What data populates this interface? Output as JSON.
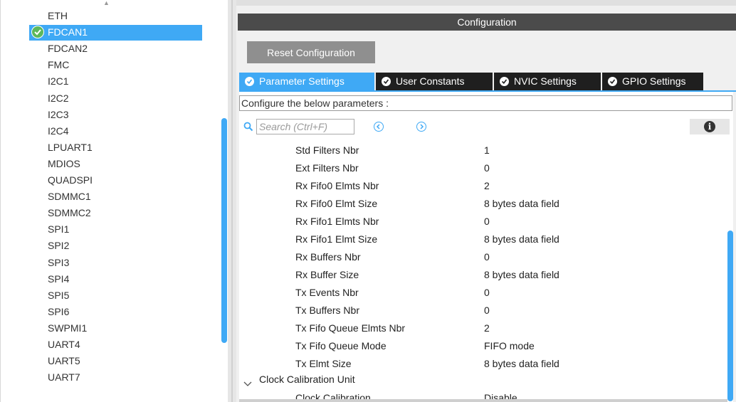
{
  "peripherals": {
    "items": [
      {
        "label": "ETH",
        "selected": false,
        "checked": false
      },
      {
        "label": "FDCAN1",
        "selected": true,
        "checked": true
      },
      {
        "label": "FDCAN2",
        "selected": false,
        "checked": false
      },
      {
        "label": "FMC",
        "selected": false,
        "checked": false
      },
      {
        "label": "I2C1",
        "selected": false,
        "checked": false
      },
      {
        "label": "I2C2",
        "selected": false,
        "checked": false
      },
      {
        "label": "I2C3",
        "selected": false,
        "checked": false
      },
      {
        "label": "I2C4",
        "selected": false,
        "checked": false
      },
      {
        "label": "LPUART1",
        "selected": false,
        "checked": false
      },
      {
        "label": "MDIOS",
        "selected": false,
        "checked": false
      },
      {
        "label": "QUADSPI",
        "selected": false,
        "checked": false
      },
      {
        "label": "SDMMC1",
        "selected": false,
        "checked": false
      },
      {
        "label": "SDMMC2",
        "selected": false,
        "checked": false
      },
      {
        "label": "SPI1",
        "selected": false,
        "checked": false
      },
      {
        "label": "SPI2",
        "selected": false,
        "checked": false
      },
      {
        "label": "SPI3",
        "selected": false,
        "checked": false
      },
      {
        "label": "SPI4",
        "selected": false,
        "checked": false
      },
      {
        "label": "SPI5",
        "selected": false,
        "checked": false
      },
      {
        "label": "SPI6",
        "selected": false,
        "checked": false
      },
      {
        "label": "SWPMI1",
        "selected": false,
        "checked": false
      },
      {
        "label": "UART4",
        "selected": false,
        "checked": false
      },
      {
        "label": "UART5",
        "selected": false,
        "checked": false
      },
      {
        "label": "UART7",
        "selected": false,
        "checked": false
      }
    ]
  },
  "config": {
    "header": "Configuration",
    "reset_label": "Reset Configuration",
    "tabs": [
      {
        "label": "Parameter Settings",
        "active": true
      },
      {
        "label": "User Constants",
        "active": false
      },
      {
        "label": "NVIC Settings",
        "active": false
      },
      {
        "label": "GPIO Settings",
        "active": false
      }
    ],
    "configure_label": "Configure the below parameters :",
    "search_placeholder": "Search (Ctrl+F)",
    "parameters": [
      {
        "name": "Std Filters Nbr",
        "value": "1"
      },
      {
        "name": "Ext Filters Nbr",
        "value": "0"
      },
      {
        "name": "Rx Fifo0 Elmts Nbr",
        "value": "2"
      },
      {
        "name": "Rx Fifo0 Elmt Size",
        "value": "8 bytes data field"
      },
      {
        "name": "Rx Fifo1 Elmts Nbr",
        "value": "0"
      },
      {
        "name": "Rx Fifo1 Elmt Size",
        "value": "8 bytes data field"
      },
      {
        "name": "Rx Buffers Nbr",
        "value": "0"
      },
      {
        "name": "Rx Buffer Size",
        "value": "8 bytes data field"
      },
      {
        "name": "Tx Events Nbr",
        "value": "0"
      },
      {
        "name": "Tx Buffers Nbr",
        "value": "0"
      },
      {
        "name": "Tx Fifo Queue Elmts Nbr",
        "value": "2"
      },
      {
        "name": "Tx Fifo Queue Mode",
        "value": "FIFO mode"
      },
      {
        "name": "Tx Elmt Size",
        "value": "8 bytes data field"
      }
    ],
    "group": {
      "name": "Clock Calibration Unit"
    },
    "group_params": [
      {
        "name": "Clock Calibration",
        "value": "Disable"
      }
    ]
  },
  "colors": {
    "accent": "#3fa9f5",
    "header_bg": "#4b4b4b",
    "tab_bg": "#1f1f1f",
    "check_green": "#5cb85c"
  },
  "icons": {
    "check": "check-circle-icon",
    "search": "search-icon",
    "prev": "chevron-left-circle-icon",
    "next": "chevron-right-circle-icon",
    "info": "info-icon",
    "collapse": "chevron-down-icon"
  }
}
